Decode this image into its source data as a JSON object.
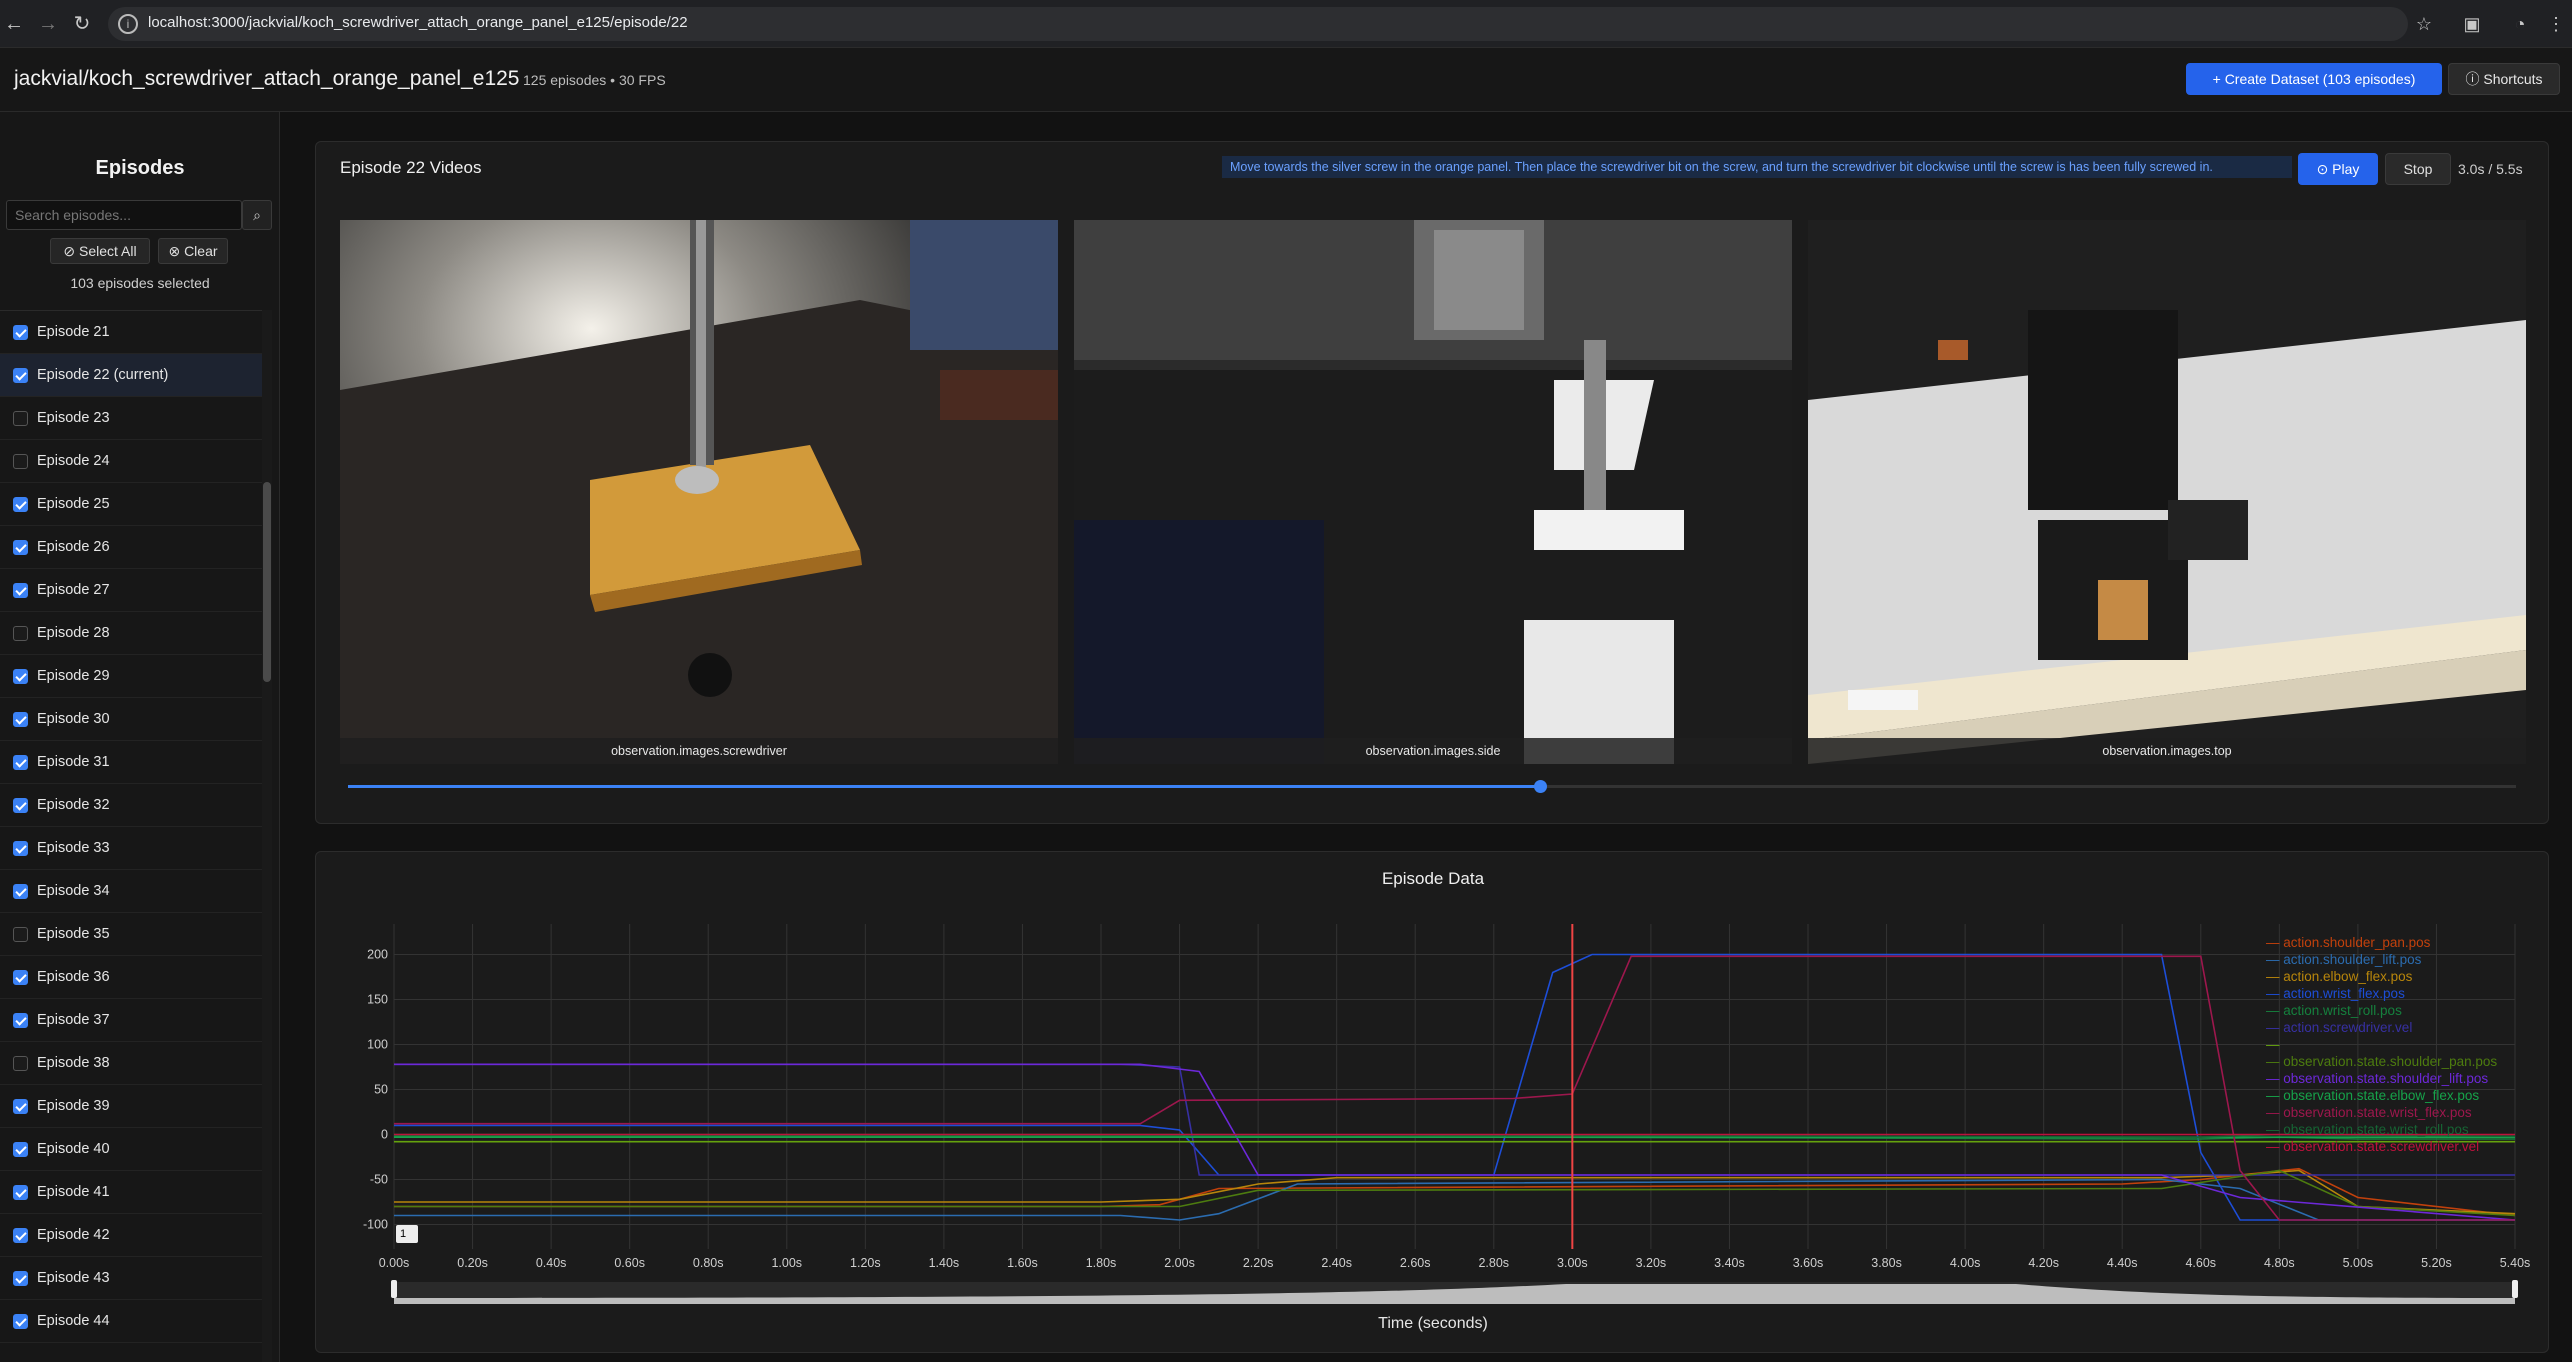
{
  "browser": {
    "url": "localhost:3000/jackvial/koch_screwdriver_attach_orange_panel_e125/episode/22"
  },
  "header": {
    "dataset_title": "jackvial/koch_screwdriver_attach_orange_panel_e125",
    "dataset_meta": "125 episodes • 30 FPS",
    "create_button": "+ Create Dataset (103 episodes)",
    "shortcuts_button": "ⓘ Shortcuts"
  },
  "sidebar": {
    "title": "Episodes",
    "search_placeholder": "Search episodes...",
    "select_all": "⊘ Select All",
    "clear": "⊗ Clear",
    "selected_count": "103 episodes selected",
    "episodes": [
      {
        "label": "Episode 21",
        "checked": true,
        "current": false
      },
      {
        "label": "Episode 22  (current)",
        "checked": true,
        "current": true
      },
      {
        "label": "Episode 23",
        "checked": false,
        "current": false
      },
      {
        "label": "Episode 24",
        "checked": false,
        "current": false
      },
      {
        "label": "Episode 25",
        "checked": true,
        "current": false
      },
      {
        "label": "Episode 26",
        "checked": true,
        "current": false
      },
      {
        "label": "Episode 27",
        "checked": true,
        "current": false
      },
      {
        "label": "Episode 28",
        "checked": false,
        "current": false
      },
      {
        "label": "Episode 29",
        "checked": true,
        "current": false
      },
      {
        "label": "Episode 30",
        "checked": true,
        "current": false
      },
      {
        "label": "Episode 31",
        "checked": true,
        "current": false
      },
      {
        "label": "Episode 32",
        "checked": true,
        "current": false
      },
      {
        "label": "Episode 33",
        "checked": true,
        "current": false
      },
      {
        "label": "Episode 34",
        "checked": true,
        "current": false
      },
      {
        "label": "Episode 35",
        "checked": false,
        "current": false
      },
      {
        "label": "Episode 36",
        "checked": true,
        "current": false
      },
      {
        "label": "Episode 37",
        "checked": true,
        "current": false
      },
      {
        "label": "Episode 38",
        "checked": false,
        "current": false
      },
      {
        "label": "Episode 39",
        "checked": true,
        "current": false
      },
      {
        "label": "Episode 40",
        "checked": true,
        "current": false
      },
      {
        "label": "Episode 41",
        "checked": true,
        "current": false
      },
      {
        "label": "Episode 42",
        "checked": true,
        "current": false
      },
      {
        "label": "Episode 43",
        "checked": true,
        "current": false
      },
      {
        "label": "Episode 44",
        "checked": true,
        "current": false
      }
    ]
  },
  "video_panel": {
    "title": "Episode 22 Videos",
    "task": "Move towards the silver screw in the orange panel. Then place the screwdriver bit on the screw, and turn the screwdriver bit clockwise until the screw is has been fully screwed in.",
    "play": "⊙ Play",
    "stop": "Stop",
    "timecode": "3.0s / 5.5s",
    "progress": 0.55,
    "videos": [
      {
        "label": "observation.images.screwdriver"
      },
      {
        "label": "observation.images.side"
      },
      {
        "label": "observation.images.top"
      }
    ]
  },
  "data_panel": {
    "title": "Episode Data",
    "zoom_label": "1"
  },
  "chart_data": {
    "type": "line",
    "xlabel": "Time (seconds)",
    "ylabel": "",
    "xlim": [
      0,
      5.4
    ],
    "ylim": [
      -100,
      200
    ],
    "x_ticks": [
      "0.00s",
      "0.20s",
      "0.40s",
      "0.60s",
      "0.80s",
      "1.00s",
      "1.20s",
      "1.40s",
      "1.60s",
      "1.80s",
      "2.00s",
      "2.20s",
      "2.40s",
      "2.60s",
      "2.80s",
      "3.00s",
      "3.20s",
      "3.40s",
      "3.60s",
      "3.80s",
      "4.00s",
      "4.20s",
      "4.40s",
      "4.60s",
      "4.80s",
      "5.00s",
      "5.20s",
      "5.40s"
    ],
    "y_ticks": [
      "200",
      "150",
      "100",
      "50",
      "0",
      "-50",
      "-100"
    ],
    "current_time": 3.0,
    "grid": true,
    "legend_position": "top-right",
    "series": [
      {
        "name": "action.shoulder_pan.pos",
        "color": "#c2410c",
        "x": [
          0,
          1.8,
          1.95,
          2.0,
          2.1,
          4.4,
          4.6,
          4.7,
          4.85,
          5.0,
          5.4
        ],
        "values": [
          -80,
          -80,
          -78,
          -72,
          -60,
          -55,
          -50,
          -45,
          -38,
          -70,
          -90
        ]
      },
      {
        "name": "action.shoulder_lift.pos",
        "color": "#2b6cb0",
        "x": [
          0,
          1.85,
          2.0,
          2.1,
          2.3,
          4.5,
          4.7,
          4.9,
          5.4
        ],
        "values": [
          -90,
          -90,
          -95,
          -88,
          -55,
          -50,
          -60,
          -95,
          -95
        ]
      },
      {
        "name": "action.elbow_flex.pos",
        "color": "#b8860b",
        "x": [
          0,
          1.8,
          2.0,
          2.2,
          2.4,
          4.5,
          4.7,
          4.85,
          5.0,
          5.4
        ],
        "values": [
          -75,
          -75,
          -72,
          -55,
          -48,
          -48,
          -45,
          -40,
          -80,
          -88
        ]
      },
      {
        "name": "action.wrist_flex.pos",
        "color": "#1d4ed8",
        "x": [
          0,
          1.9,
          2.0,
          2.1,
          2.8,
          2.95,
          3.05,
          4.5,
          4.6,
          4.7,
          5.4
        ],
        "values": [
          10,
          10,
          5,
          -45,
          -45,
          180,
          200,
          200,
          -20,
          -95,
          -95
        ]
      },
      {
        "name": "action.wrist_roll.pos",
        "color": "#15803d",
        "x": [
          0,
          2.0,
          4.6,
          4.8,
          5.0,
          5.4
        ],
        "values": [
          -2,
          -2,
          -5,
          -3,
          -5,
          -5
        ]
      },
      {
        "name": "action.screwdriver.vel",
        "color": "#3730a3",
        "x": [
          0,
          1.85,
          2.0,
          2.05,
          4.6,
          5.4
        ],
        "values": [
          78,
          78,
          75,
          -45,
          -45,
          -45
        ]
      },
      {
        "name": "",
        "color": "#65a30d",
        "x": [
          0,
          5.4
        ],
        "values": [
          -8,
          -8
        ]
      },
      {
        "name": "observation.state.shoulder_pan.pos",
        "color": "#4d7c0f",
        "x": [
          0,
          2.0,
          2.2,
          4.5,
          4.8,
          5.0,
          5.4
        ],
        "values": [
          -80,
          -80,
          -62,
          -60,
          -40,
          -80,
          -90
        ]
      },
      {
        "name": "observation.state.shoulder_lift.pos",
        "color": "#6d28d9",
        "x": [
          0,
          1.9,
          2.05,
          2.2,
          4.5,
          4.7,
          5.4
        ],
        "values": [
          78,
          78,
          70,
          -45,
          -45,
          -70,
          -95
        ]
      },
      {
        "name": "observation.state.elbow_flex.pos",
        "color": "#16a34a",
        "x": [
          0,
          5.4
        ],
        "values": [
          -3,
          -3
        ]
      },
      {
        "name": "observation.state.wrist_flex.pos",
        "color": "#9d174d",
        "x": [
          0,
          1.9,
          2.0,
          2.85,
          3.0,
          3.15,
          4.6,
          4.7,
          4.8,
          5.4
        ],
        "values": [
          12,
          12,
          38,
          40,
          45,
          198,
          198,
          -40,
          -95,
          -95
        ]
      },
      {
        "name": "observation.state.wrist_roll.pos",
        "color": "#166534",
        "x": [
          0,
          2.0,
          4.6,
          4.8,
          5.4
        ],
        "values": [
          0,
          0,
          -3,
          0,
          -2
        ]
      },
      {
        "name": "observation.state.screwdriver.vel",
        "color": "#be123c",
        "x": [
          0,
          5.4
        ],
        "values": [
          0,
          0
        ]
      }
    ]
  }
}
